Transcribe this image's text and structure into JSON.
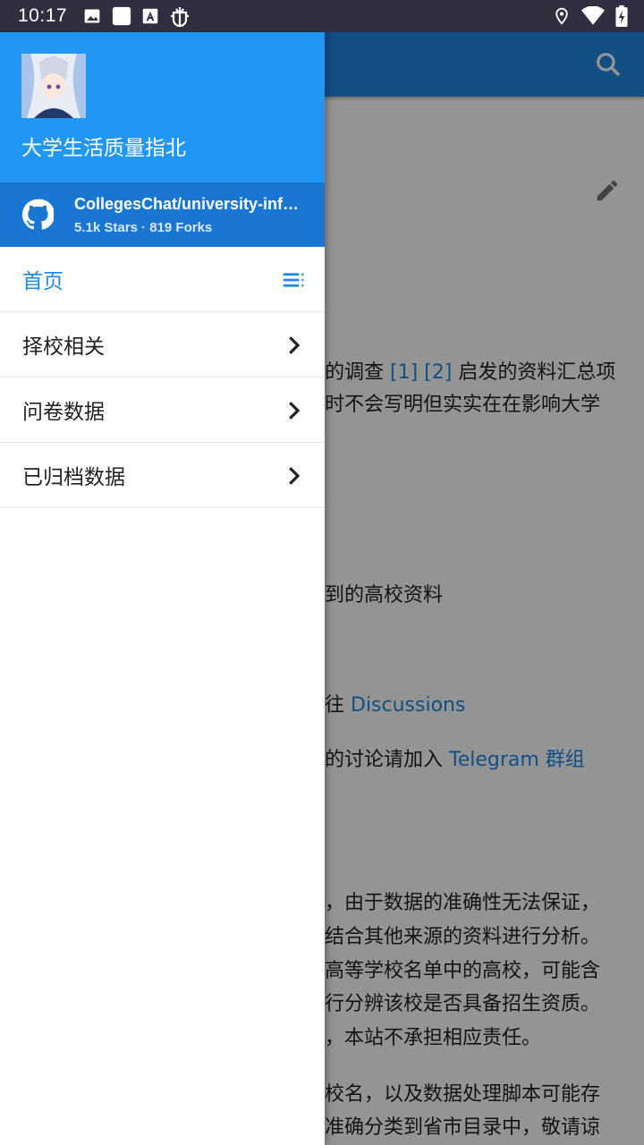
{
  "status_bar": {
    "time": "10:17",
    "left_icons": [
      "image-icon",
      "notification-square-icon",
      "font-icon",
      "bug-icon"
    ],
    "right_icons": [
      "location-icon",
      "wifi-icon",
      "battery-charging-icon"
    ]
  },
  "drawer": {
    "site_title": "大学生活质量指北",
    "repo": {
      "name": "CollegesChat/university-information",
      "stats": "5.1k Stars · 819 Forks"
    },
    "nav_items": [
      {
        "label": "首页",
        "active": true,
        "trail_icon": "toc-list-icon"
      },
      {
        "label": "择校相关",
        "active": false,
        "trail_icon": "chevron-right-icon"
      },
      {
        "label": "问卷数据",
        "active": false,
        "trail_icon": "chevron-right-icon"
      },
      {
        "label": "已归档数据",
        "active": false,
        "trail_icon": "chevron-right-icon"
      }
    ]
  },
  "background_page": {
    "lines": [
      {
        "pre": "的调查 ",
        "links": [
          "[1]",
          "[2]"
        ],
        "post": " 启发的资料汇总项"
      },
      {
        "pre": "时不会写明但实实在在影响大学",
        "links": [],
        "post": ""
      },
      {
        "pre": "到的高校资料",
        "links": [],
        "post": ""
      },
      {
        "pre": "往 ",
        "links": [
          "Discussions"
        ],
        "post": ""
      },
      {
        "pre": "的讨论请加入 ",
        "links": [
          "Telegram 群组"
        ],
        "post": ""
      },
      {
        "pre": "，由于数据的准确性无法保证，",
        "links": [],
        "post": ""
      },
      {
        "pre": "结合其他来源的资料进行分析。",
        "links": [],
        "post": ""
      },
      {
        "pre": "高等学校名单中的高校，可能含",
        "links": [],
        "post": ""
      },
      {
        "pre": "行分辨该校是否具备招生资质。",
        "links": [],
        "post": ""
      },
      {
        "pre": "，本站不承担相应责任。",
        "links": [],
        "post": ""
      },
      {
        "pre": "校名，以及数据处理脚本可能存",
        "links": [],
        "post": ""
      },
      {
        "pre": "准确分类到省市目录中，敬请谅",
        "links": [],
        "post": ""
      }
    ]
  },
  "colors": {
    "primary": "#2196f3",
    "primary_dark": "#1976d2",
    "accent_text": "#1e88e5",
    "status_bar": "#2f2f3f"
  }
}
